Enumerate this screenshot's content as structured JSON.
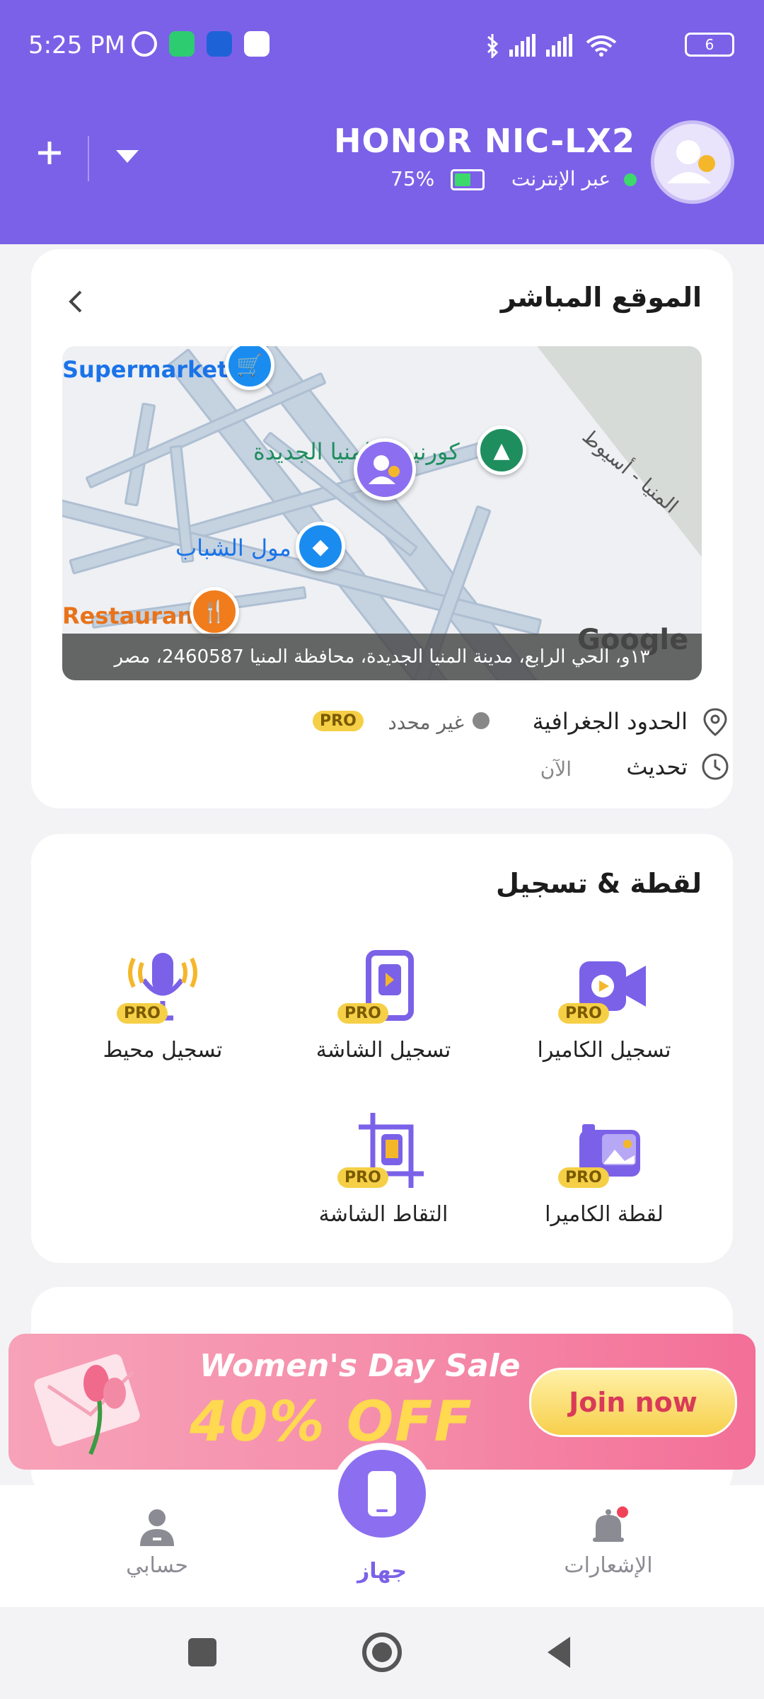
{
  "status_bar": {
    "time": "5:25 PM",
    "battery": "6"
  },
  "header": {
    "device_name": "HONOR NIC-LX2",
    "online_status": "عبر الإنترنت",
    "battery_percent": "75%",
    "add_icon": "plus-icon",
    "dropdown_icon": "chevron-down-icon"
  },
  "live_location": {
    "title": "الموقع المباشر",
    "map": {
      "supermarket": "Supermarket",
      "restaurant": "Restaurant",
      "mall": "مول الشباب",
      "park_label": "كورنيش المنيا الجديدة",
      "road": "المنيا - أسيوط",
      "google": "Google",
      "address": "١٣و، الحي الرابع، مدينة المنيا الجديدة، محافظة المنيا 2460587، مصر"
    },
    "geofence_label": "الحدود الجغرافية",
    "geofence_status": "غير محدد",
    "pro": "PRO",
    "update_label": "تحديث",
    "update_value": "الآن"
  },
  "capture": {
    "title": "لقطة & تسجيل",
    "items": [
      {
        "label": "تسجيل الكاميرا",
        "pro": "PRO"
      },
      {
        "label": "تسجيل الشاشة",
        "pro": "PRO"
      },
      {
        "label": "تسجيل محيط",
        "pro": "PRO"
      },
      {
        "label": "لقطة الكاميرا",
        "pro": "PRO"
      },
      {
        "label": "التقاط الشاشة",
        "pro": "PRO"
      }
    ]
  },
  "banner": {
    "title": "Women's Day Sale",
    "discount": "40% OFF",
    "cta": "Join now"
  },
  "bottom_nav": {
    "notifications": "الإشعارات",
    "device": "جهاز",
    "account": "حسابي"
  },
  "colors": {
    "primary": "#7b61e8",
    "pro": "#f5cf46",
    "banner": "#f58eab",
    "cta_text": "#d93a58"
  }
}
